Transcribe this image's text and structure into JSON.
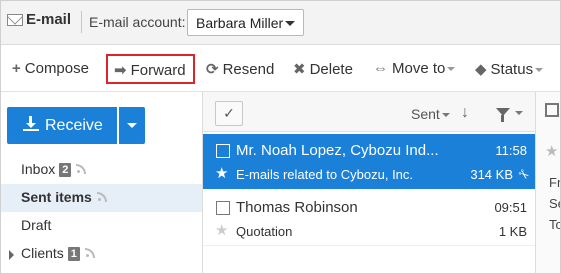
{
  "header": {
    "app_title": "E-mail",
    "account_label": "E-mail account:",
    "account_value": "Barbara Miller"
  },
  "toolbar": {
    "compose": "Compose",
    "forward": "Forward",
    "resend": "Resend",
    "delete": "Delete",
    "move_to": "Move to",
    "status": "Status"
  },
  "sidebar": {
    "receive_label": "Receive",
    "folders": [
      {
        "label": "Inbox",
        "badge": "2"
      },
      {
        "label": "Sent items",
        "badge": ""
      },
      {
        "label": "Draft",
        "badge": ""
      },
      {
        "label": "Clients",
        "badge": "1"
      }
    ],
    "selected_folder": "Sent items"
  },
  "list": {
    "sort_label": "Sent",
    "mails": [
      {
        "from": "Mr. Noah Lopez, Cybozu Ind...",
        "time": "11:58",
        "subject": "E-mails related to Cybozu, Inc.",
        "size": "314 KB",
        "attachment": true,
        "selected": true
      },
      {
        "from": "Thomas Robinson",
        "time": "09:51",
        "subject": "Quotation",
        "size": "1 KB",
        "attachment": false,
        "selected": false
      }
    ]
  },
  "preview": {
    "fragments": [
      "Fr",
      "Se",
      "To"
    ]
  },
  "colors": {
    "accent": "#1a80d8",
    "highlight_border": "#d9262b",
    "selected_folder_bg": "#e6eef8"
  }
}
